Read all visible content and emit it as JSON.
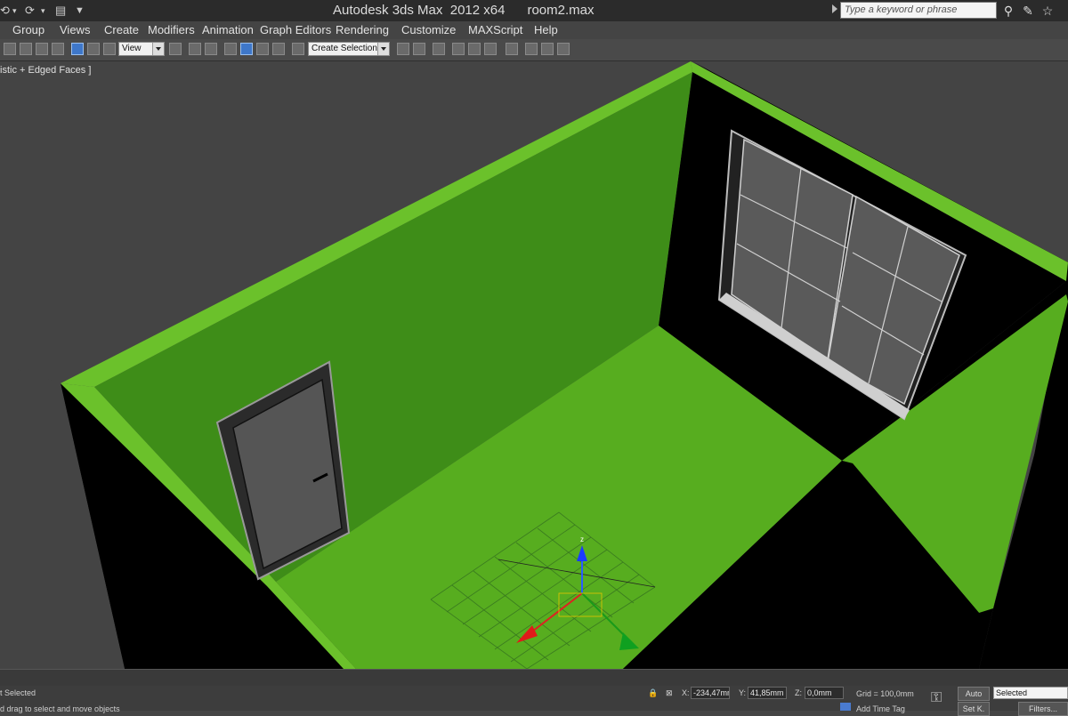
{
  "window": {
    "title": "Autodesk 3ds Max  2012 x64      room2.max",
    "search_placeholder": "Type a keyword or phrase"
  },
  "quick_access": {
    "undo_icon": "undo-icon",
    "redo_icon": "redo-icon",
    "project_icon": "project-folder-icon"
  },
  "info_center_icons": [
    "binoculars-icon",
    "wrench-icon",
    "star-icon"
  ],
  "menu": {
    "items": [
      "Group",
      "Views",
      "Create",
      "Modifiers",
      "Animation",
      "Graph Editors",
      "Rendering",
      "Customize",
      "MAXScript",
      "Help"
    ]
  },
  "toolbar": {
    "reference_coord": "View",
    "named_selection": "Create Selection Se"
  },
  "viewport": {
    "label": "istic + Edged Faces ]",
    "axes": {
      "z": "z"
    },
    "colors": {
      "wall_green": "#3e8d18",
      "wall_dark": "#1d3d0e",
      "floor_green": "#57ad1f",
      "rim_green": "#6bc12b",
      "outer_wall": "#000000",
      "background": "#444444"
    }
  },
  "status": {
    "selection_text": "t Selected",
    "prompt_text": "d drag to select and move objects",
    "x_label": "X:",
    "x_value": "-234,47mm",
    "y_label": "Y:",
    "y_value": "41,85mm",
    "z_label": "Z:",
    "z_value": "0,0mm",
    "grid_text": "Grid = 100,0mm",
    "add_time_tag": "Add Time Tag",
    "auto_label": "Auto",
    "setkey_label": "Set K.",
    "selected_label": "Selected",
    "filters_label": "Filters..."
  }
}
